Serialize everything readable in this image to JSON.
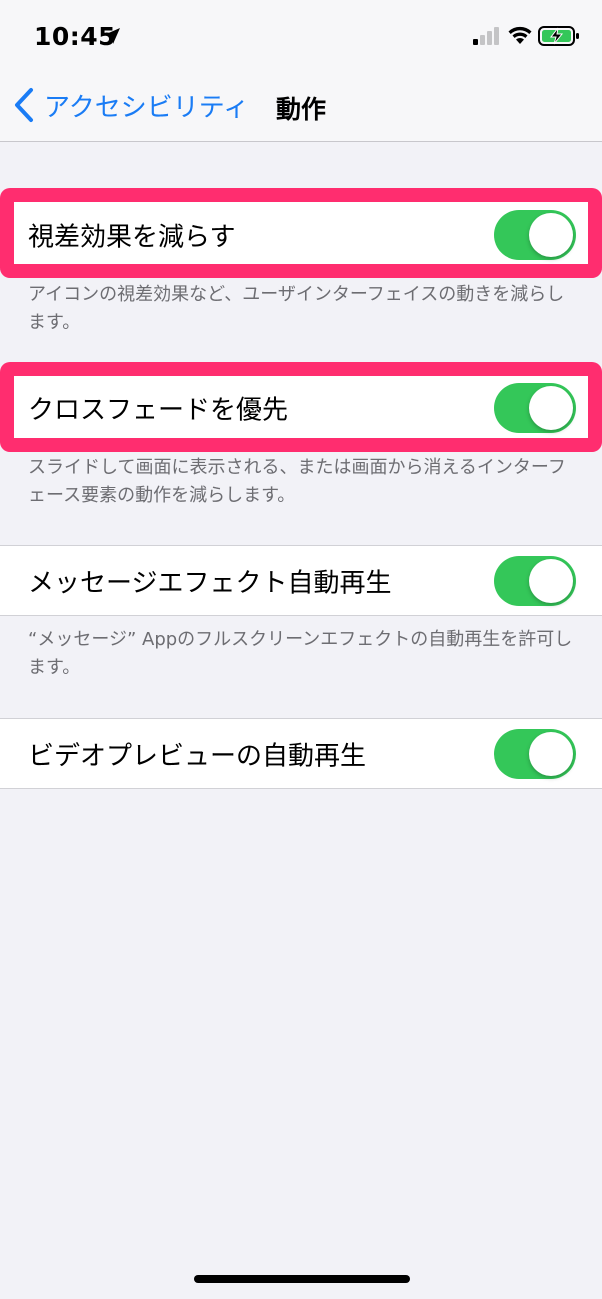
{
  "status_bar": {
    "time": "10:45",
    "location_icon": "location-arrow-icon",
    "signal_icon": "cellular-signal-icon",
    "wifi_icon": "wifi-icon",
    "battery_icon": "battery-charging-icon"
  },
  "nav": {
    "back_label": "アクセシビリティ",
    "title": "動作"
  },
  "settings": [
    {
      "label": "視差効果を減らす",
      "enabled": true,
      "footer": "アイコンの視差効果など、ユーザインターフェイスの動きを減らします。",
      "highlighted": true
    },
    {
      "label": "クロスフェードを優先",
      "enabled": true,
      "footer": "スライドして画面に表示される、または画面から消えるインターフェース要素の動作を減らします。",
      "highlighted": true
    },
    {
      "label": "メッセージエフェクト自動再生",
      "enabled": true,
      "footer": "“メッセージ” Appのフルスクリーンエフェクトの自動再生を許可します。",
      "highlighted": false
    },
    {
      "label": "ビデオプレビューの自動再生",
      "enabled": true,
      "footer": "",
      "highlighted": false
    }
  ],
  "colors": {
    "accent": "#1a7cf5",
    "toggle_on": "#34c759",
    "highlight": "#ff2d6f",
    "background": "#f2f2f7"
  }
}
